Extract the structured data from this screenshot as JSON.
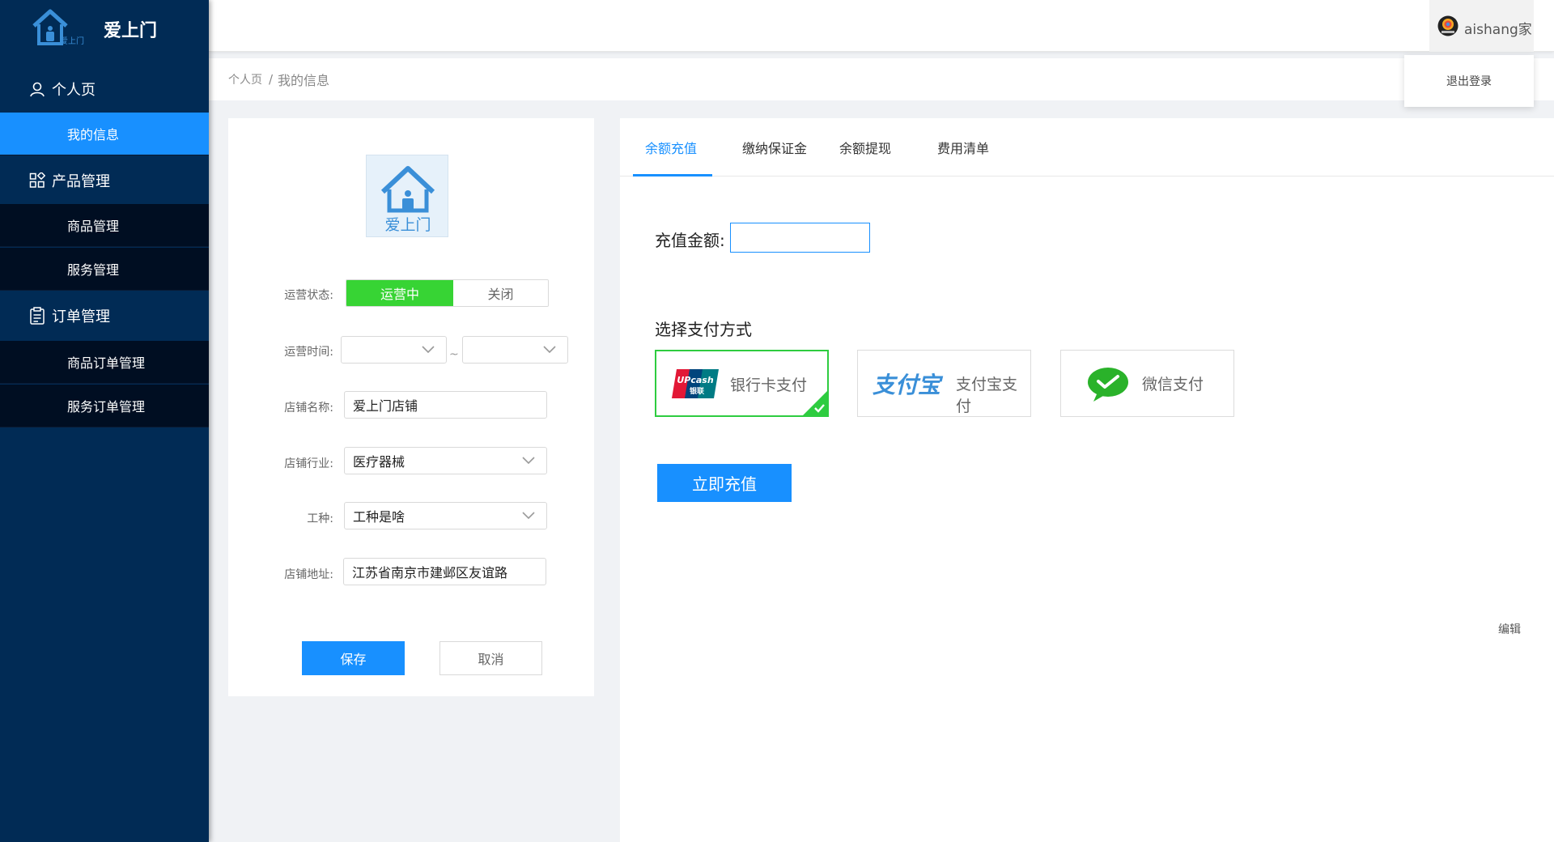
{
  "app": {
    "name": "爱上门",
    "logo_text": "爱上门"
  },
  "sidebar": {
    "groups": [
      {
        "label": "个人页",
        "icon": "user-icon"
      },
      {
        "label": "产品管理",
        "icon": "apps-icon"
      },
      {
        "label": "订单管理",
        "icon": "clipboard-icon"
      }
    ],
    "items": [
      {
        "label": "我的信息",
        "active": true
      },
      {
        "label": "商品管理"
      },
      {
        "label": "服务管理"
      },
      {
        "label": "商品订单管理"
      },
      {
        "label": "服务订单管理"
      }
    ]
  },
  "header": {
    "user_name": "aishang家",
    "logout_label": "退出登录"
  },
  "breadcrumb": {
    "items": [
      "个人页",
      "我的信息"
    ],
    "separator": "/"
  },
  "profile": {
    "shop_logo_text": "爱上门",
    "status_label": "运营状态:",
    "status_on": "运营中",
    "status_off": "关闭",
    "time_label": "运营时间:",
    "time_separator": "~",
    "name_label": "店铺名称:",
    "name_value": "爱上门店铺",
    "industry_label": "店铺行业:",
    "industry_value": "医疗器械",
    "worktype_label": "工种:",
    "worktype_value": "工种是啥",
    "address_label": "店铺地址:",
    "address_value": "江苏省南京市建邺区友谊路",
    "save_label": "保存",
    "cancel_label": "取消"
  },
  "recharge": {
    "tabs": [
      "余额充值",
      "缴纳保证金",
      "余额提现",
      "费用清单"
    ],
    "active_tab": 0,
    "amount_label": "充值金额:",
    "amount_value": "",
    "pay_title": "选择支付方式",
    "methods": [
      {
        "label": "银行卡支付",
        "icon": "unionpay-icon",
        "selected": true
      },
      {
        "label": "支付宝支付",
        "icon": "alipay-icon",
        "selected": false
      },
      {
        "label": "微信支付",
        "icon": "wechat-pay-icon",
        "selected": false
      }
    ],
    "submit_label": "立即充值",
    "edit_label": "编辑"
  },
  "colors": {
    "sidebar_bg": "#012b55",
    "sidebar_sub_bg": "#000e22",
    "accent": "#1890ff",
    "toggle_on": "#37d434"
  }
}
